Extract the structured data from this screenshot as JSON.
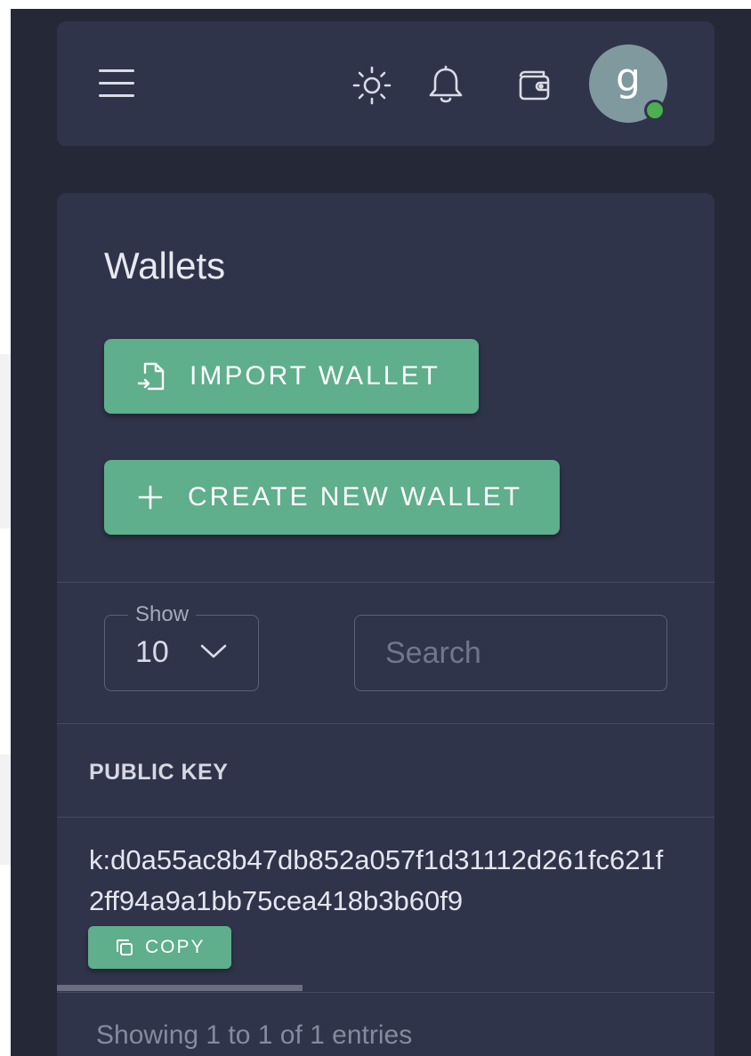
{
  "header": {
    "avatar_letter": "g",
    "icons": [
      "menu-icon",
      "sun-icon",
      "bell-icon",
      "wallet-icon"
    ]
  },
  "page": {
    "title": "Wallets"
  },
  "buttons": {
    "import_label": "IMPORT WALLET",
    "create_label": "CREATE NEW WALLET",
    "copy_label": "COPY"
  },
  "table_controls": {
    "show_label": "Show",
    "show_value": "10",
    "search_placeholder": "Search"
  },
  "table": {
    "columns": [
      "PUBLIC KEY"
    ],
    "rows": [
      {
        "public_key": "k:d0a55ac8b47db852a057f1d31112d261fc621f2ff94a9a1bb75cea418b3b60f9"
      }
    ],
    "footer": "Showing 1 to 1 of 1 entries"
  },
  "colors": {
    "background": "#252837",
    "card": "#30344a",
    "accent": "#5fae8c",
    "online": "#4caf50",
    "avatar": "#7f999f"
  }
}
